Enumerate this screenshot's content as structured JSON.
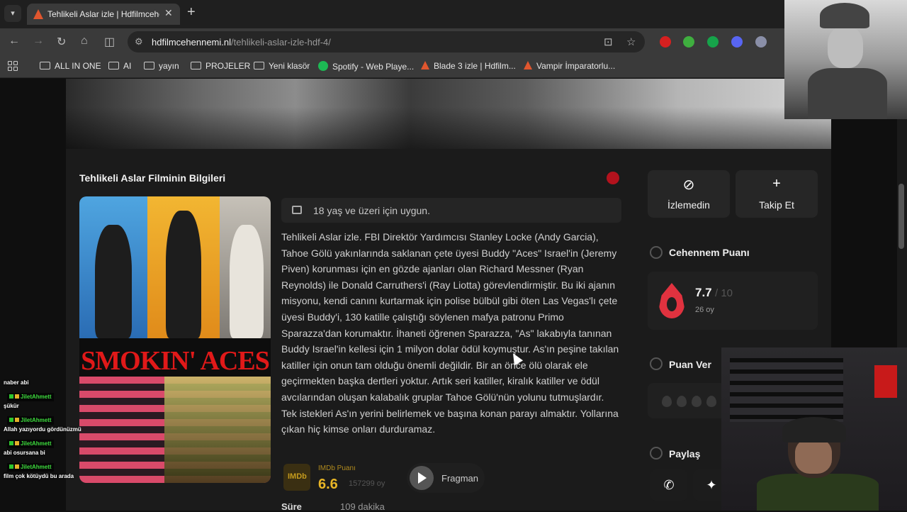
{
  "browser": {
    "tab_title": "Tehlikeli Aslar izle | Hdfilmceher",
    "tab_close": "✕",
    "new_tab": "+",
    "url_host": "hdfilmcehennemi.nl",
    "url_path": "/tehlikeli-aslar-izle-hdf-4/",
    "bookmarks": [
      {
        "label": "ALL IN ONE",
        "icon": "folder-icon"
      },
      {
        "label": "AI",
        "icon": "folder-icon"
      },
      {
        "label": "yayın",
        "icon": "folder-icon"
      },
      {
        "label": "PROJELER",
        "icon": "folder-icon"
      },
      {
        "label": "Yeni klasör",
        "icon": "folder-icon"
      },
      {
        "label": "Spotify - Web Playe...",
        "icon": "spotify-icon"
      },
      {
        "label": "Blade 3 izle | Hdfilm...",
        "icon": "site-favicon"
      },
      {
        "label": "Vampir İmparatorlu...",
        "icon": "site-favicon"
      }
    ]
  },
  "movie": {
    "section_title": "Tehlikeli Aslar Filminin Bilgileri",
    "poster_title": "SMOKIN' ACES",
    "age_rating": "18 yaş ve üzeri için uygun.",
    "description": "Tehlikeli Aslar izle. FBI Direktör Yardımcısı Stanley Locke (Andy Garcia), Tahoe Gölü yakınlarında saklanan çete üyesi Buddy \"Aces\" Israel'in (Jeremy Piven) korunması için en gözde ajanları olan Richard Messner (Ryan Reynolds) ile Donald Carruthers'i (Ray Liotta) görevlendirmiştir. Bu iki ajanın misyonu, kendi canını kurtarmak için polise bülbül gibi öten Las Vegas'lı çete üyesi Buddy'i, 130 katille çalıştığı söylenen mafya patronu Primo Sparazza'dan korumaktır. İhaneti öğrenen Sparazza, \"As\" lakabıyla tanınan Buddy Israel'in kellesi için 1 milyon dolar ödül koymuştur. As'ın peşine takılan katiller için onun tam olduğu önemli değildir. Bir an önce ölü olarak ele geçirmekten başka dertleri yoktur. Artık seri katiller, kiralık katiller ve ödül avcılarından oluşan kalabalık gruplar Tahoe Gölü'nün yolunu tutmuşlardır. Tek istekleri As'ın yerini belirlemek ve başına konan parayı almaktır. Yollarına çıkan hiç kimse onları durduramaz.",
    "imdb_logo": "IMDb",
    "imdb_label": "IMDb Puanı",
    "imdb_score": "6.6",
    "imdb_votes": "157299 oy",
    "trailer_label": "Fragman",
    "duration_label": "Süre",
    "duration_value": "109 dakika"
  },
  "sidebar": {
    "not_watched_label": "İzlemedin",
    "follow_label": "Takip Et",
    "cehennem_heading": "Cehennem Puanı",
    "score": "7.7",
    "score_max": "/ 10",
    "score_votes": "26 oy",
    "rate_heading": "Puan Ver",
    "share_heading": "Paylaş"
  },
  "chat": [
    {
      "user": "",
      "message": "naber abi"
    },
    {
      "user": "JiletAhmett",
      "message": "şükür"
    },
    {
      "user": "JiletAhmett",
      "message": "Allah yazıyordu gördünüzmü"
    },
    {
      "user": "JiletAhmett",
      "message": "abi osursana bi"
    },
    {
      "user": "JiletAhmett",
      "message": "film çok kötüydü bu arada"
    }
  ],
  "colors": {
    "accent_red": "#e0323f",
    "imdb_gold": "#e8b526",
    "page_bg": "#1b1b1b"
  }
}
